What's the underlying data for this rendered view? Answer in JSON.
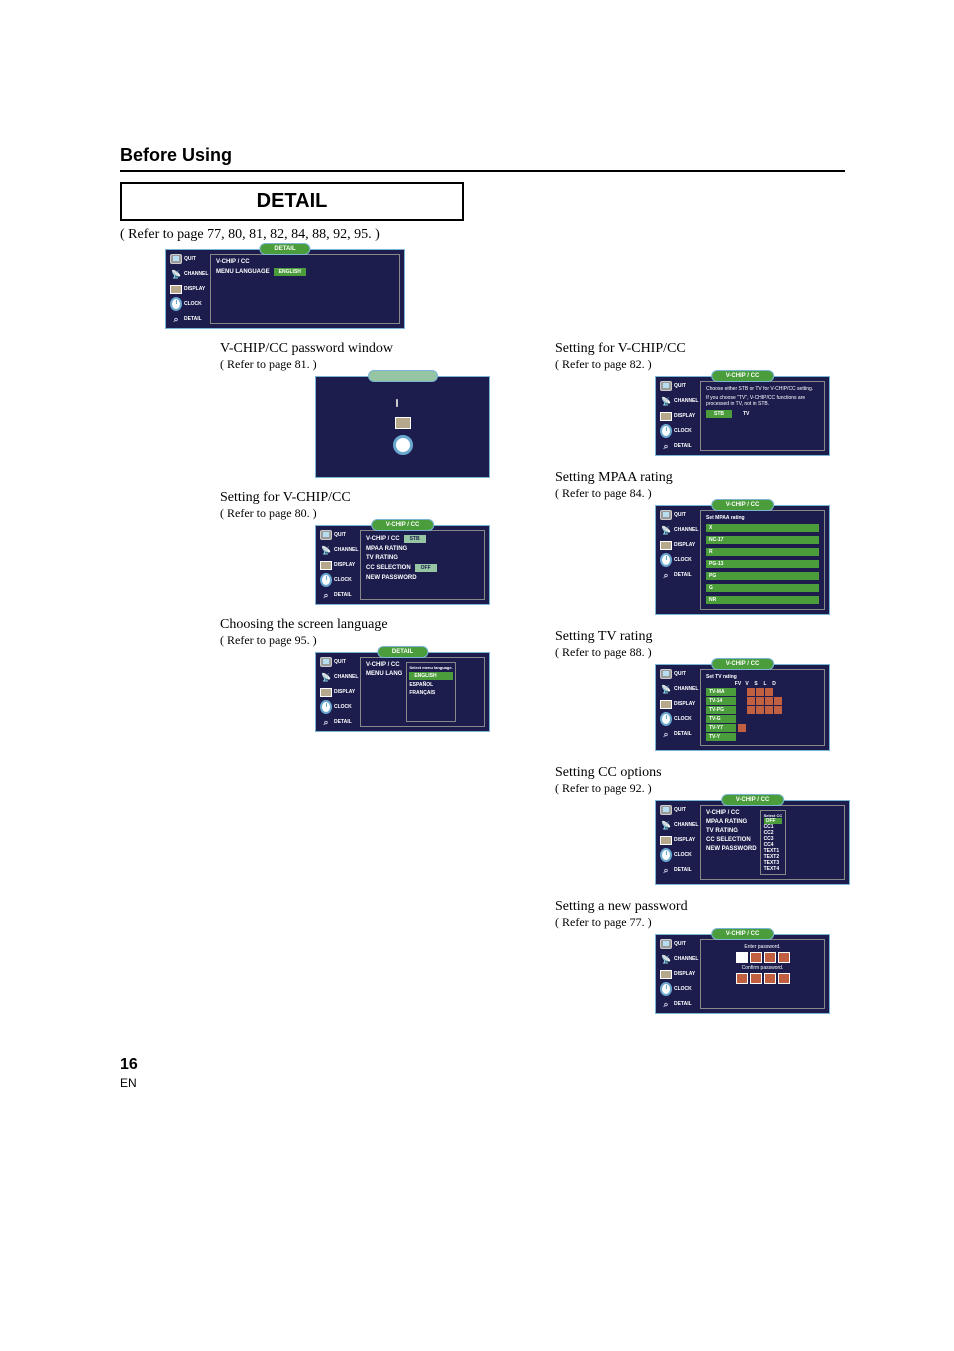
{
  "page": {
    "section_title": "Before Using",
    "detail_heading": "DETAIL",
    "refer_main": "( Refer to page 77, 80, 81, 82, 84, 88, 92, 95. )",
    "page_number": "16",
    "page_lang": "EN"
  },
  "sidebar": {
    "quit": "QUIT",
    "channel": "CHANNEL",
    "display": "DISPLAY",
    "clock": "CLOCK",
    "detail": "DETAIL"
  },
  "detail_osd": {
    "title": "DETAIL",
    "row1_label": "V-CHIP / CC",
    "row2_label": "MENU LANGUAGE",
    "row2_value": "ENGLISH"
  },
  "vcpw": {
    "heading": "V-CHIP/CC password window",
    "refer": "( Refer to page 81. )"
  },
  "vchip80": {
    "heading": "Setting for V-CHIP/CC",
    "refer": "( Refer to page 80. )",
    "title": "V-CHIP / CC",
    "rows": {
      "vchipcc": "V-CHIP / CC",
      "vchipcc_val": "STB",
      "mpaa": "MPAA RATING",
      "tvrating": "TV RATING",
      "cc": "CC SELECTION",
      "cc_val": "OFF",
      "newpw": "NEW PASSWORD"
    }
  },
  "lang": {
    "heading": "Choosing the screen language",
    "refer": "( Refer to page 95. )",
    "title": "DETAIL",
    "row_vchip": "V-CHIP / CC",
    "row_menu": "MENU LANG",
    "popup_title": "Select menu language.",
    "opt1": "ENGLISH",
    "opt2": "ESPAÑOL",
    "opt3": "FRANÇAIS"
  },
  "vchip82": {
    "heading": "Setting for V-CHIP/CC",
    "refer": "( Refer to page 82. )",
    "title": "V-CHIP / CC",
    "note1": "Choose either STB or TV for V-CHIP/CC setting.",
    "note2": "If you choose \"TV\", V-CHIP/CC functions are processed in TV, not in STB.",
    "stb": "STB",
    "tv": "TV"
  },
  "mpaa": {
    "heading": "Setting MPAA rating",
    "refer": "( Refer to page 84. )",
    "title": "V-CHIP / CC",
    "panel_title": "Set MPAA rating",
    "ratings": [
      "X",
      "NC-17",
      "R",
      "PG-13",
      "PG",
      "G",
      "NR"
    ]
  },
  "tvrating": {
    "heading": "Setting TV rating",
    "refer": "( Refer to page 88. )",
    "title": "V-CHIP / CC",
    "panel_title": "Set TV rating",
    "cols": [
      "FV",
      "V",
      "S",
      "L",
      "D"
    ],
    "rows": [
      "TV-MA",
      "TV-14",
      "TV-PG",
      "TV-G",
      "TV-Y7",
      "TV-Y"
    ]
  },
  "cc": {
    "heading": "Setting CC options",
    "refer": "( Refer to page 92. )",
    "title": "V-CHIP / CC",
    "left_rows": {
      "vchipcc": "V-CHIP / CC",
      "mpaa": "MPAA RATING",
      "tvrating": "TV RATING",
      "cc": "CC SELECTION",
      "newpw": "NEW PASSWORD"
    },
    "popup_title": "Select CC",
    "options": [
      "OFF",
      "CC1",
      "CC2",
      "CC3",
      "CC4",
      "TEXT1",
      "TEXT2",
      "TEXT3",
      "TEXT4"
    ]
  },
  "newpw": {
    "heading": "Setting a new password",
    "refer": "( Refer to page 77. )",
    "title": "V-CHIP / CC",
    "enter": "Enter password.",
    "confirm": "Confirm password."
  }
}
